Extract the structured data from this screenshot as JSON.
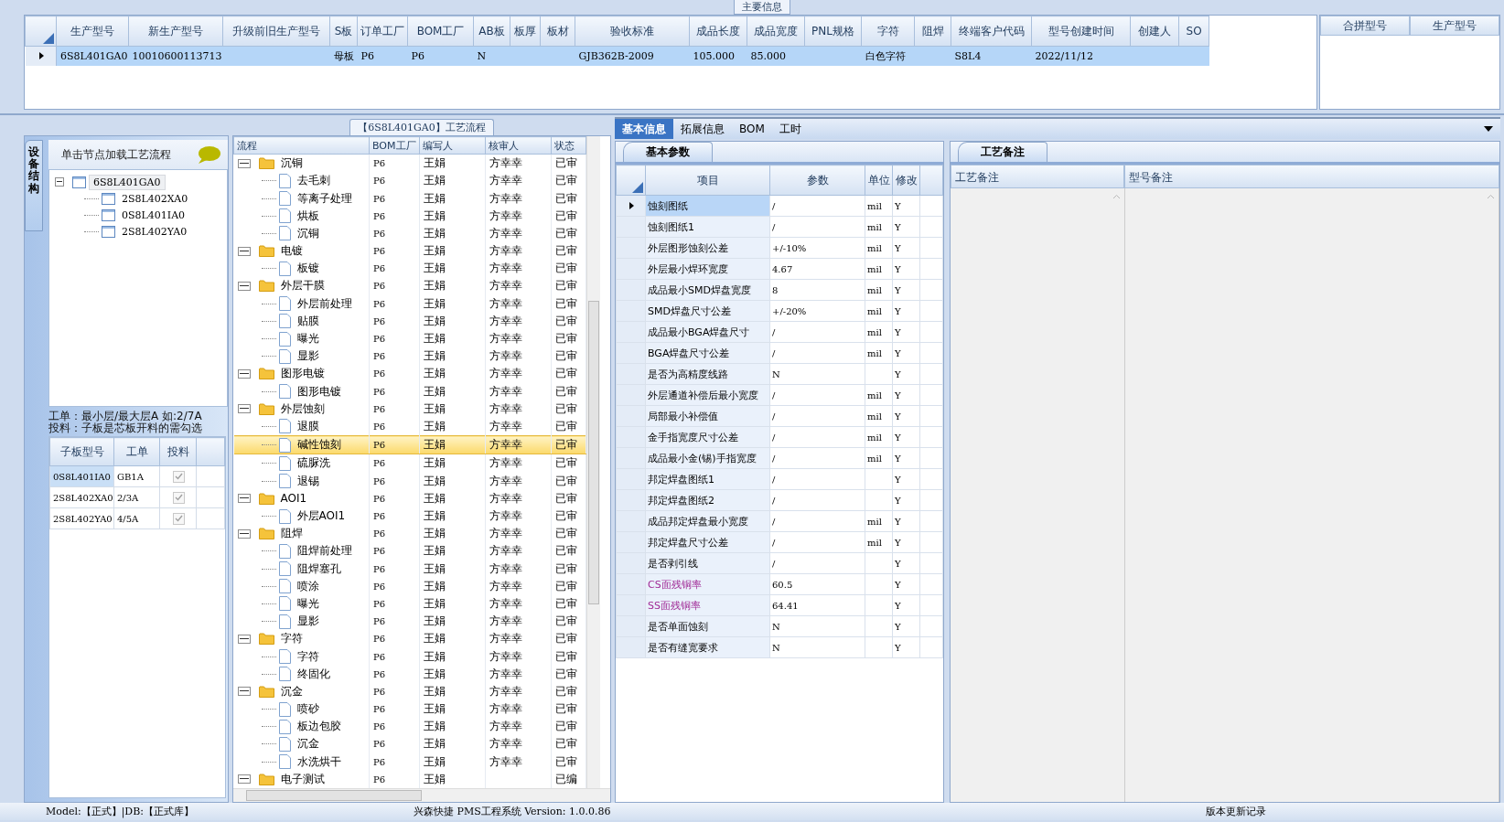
{
  "main_info": {
    "title": "主要信息",
    "columns": [
      "生产型号",
      "新生产型号",
      "升级前旧生产型号",
      "S板",
      "订单工厂",
      "BOM工厂",
      "AB板",
      "板厚",
      "板材",
      "验收标准",
      "成品长度",
      "成品宽度",
      "PNL规格",
      "字符",
      "阻焊",
      "终端客户代码",
      "型号创建时间",
      "创建人",
      "SO"
    ],
    "rows": [
      {
        "selected": true,
        "cells": [
          "6S8L401GA0",
          "10010600113713",
          null,
          "母板",
          "P6",
          "P6",
          "N",
          null,
          null,
          "GJB362B-2009",
          "105.000",
          "85.000",
          null,
          "白色字符",
          null,
          "S8L4",
          "2022/11/12",
          null,
          null
        ]
      }
    ]
  },
  "merge_grid": {
    "columns": [
      "合拼型号",
      "生产型号"
    ]
  },
  "structure_panel": {
    "side_tab": "设备结构",
    "hint": "单击节点加载工艺流程",
    "tree": [
      {
        "label": "6S8L401GA0",
        "expanded": true,
        "selected": true,
        "children": [
          {
            "label": "2S8L402XA0",
            "selected": false
          },
          {
            "label": "0S8L401IA0",
            "selected": false
          },
          {
            "label": "2S8L402YA0",
            "selected": false
          }
        ]
      }
    ],
    "notes": [
      "工单：最小层/最大层A 如:2/7A",
      "投料：子板是芯板开料的需勾选"
    ],
    "sub_boards": {
      "columns": [
        "子板型号",
        "工单",
        "投料"
      ],
      "rows": [
        {
          "cells": [
            "0S8L401IA0",
            "GB1A"
          ],
          "checked": true,
          "selected": true
        },
        {
          "cells": [
            "2S8L402XA0",
            "2/3A"
          ],
          "checked": true,
          "selected": false
        },
        {
          "cells": [
            "2S8L402YA0",
            "4/5A"
          ],
          "checked": true,
          "selected": false
        }
      ]
    }
  },
  "process_panel": {
    "title": "【6S8L401GA0】工艺流程",
    "columns": [
      "流程",
      "BOM工厂",
      "编写人",
      "核审人",
      "状态"
    ],
    "tree": [
      {
        "name": "沉铜",
        "bom": "P6",
        "writer": "王娟",
        "reviewer": "方幸幸",
        "status": "已审",
        "expanded": true,
        "selected": false,
        "children": [
          {
            "name": "去毛刺",
            "bom": "P6",
            "writer": "王娟",
            "reviewer": "方幸幸",
            "status": "已审",
            "selected": false
          },
          {
            "name": "等离子处理",
            "bom": "P6",
            "writer": "王娟",
            "reviewer": "方幸幸",
            "status": "已审",
            "selected": false
          },
          {
            "name": "烘板",
            "bom": "P6",
            "writer": "王娟",
            "reviewer": "方幸幸",
            "status": "已审",
            "selected": false
          },
          {
            "name": "沉铜",
            "bom": "P6",
            "writer": "王娟",
            "reviewer": "方幸幸",
            "status": "已审",
            "selected": false
          }
        ]
      },
      {
        "name": "电镀",
        "bom": "P6",
        "writer": "王娟",
        "reviewer": "方幸幸",
        "status": "已审",
        "expanded": true,
        "selected": false,
        "children": [
          {
            "name": "板镀",
            "bom": "P6",
            "writer": "王娟",
            "reviewer": "方幸幸",
            "status": "已审",
            "selected": false
          }
        ]
      },
      {
        "name": "外层干膜",
        "bom": "P6",
        "writer": "王娟",
        "reviewer": "方幸幸",
        "status": "已审",
        "expanded": true,
        "selected": false,
        "children": [
          {
            "name": "外层前处理",
            "bom": "P6",
            "writer": "王娟",
            "reviewer": "方幸幸",
            "status": "已审",
            "selected": false
          },
          {
            "name": "贴膜",
            "bom": "P6",
            "writer": "王娟",
            "reviewer": "方幸幸",
            "status": "已审",
            "selected": false
          },
          {
            "name": "曝光",
            "bom": "P6",
            "writer": "王娟",
            "reviewer": "方幸幸",
            "status": "已审",
            "selected": false
          },
          {
            "name": "显影",
            "bom": "P6",
            "writer": "王娟",
            "reviewer": "方幸幸",
            "status": "已审",
            "selected": false
          }
        ]
      },
      {
        "name": "图形电镀",
        "bom": "P6",
        "writer": "王娟",
        "reviewer": "方幸幸",
        "status": "已审",
        "expanded": true,
        "selected": false,
        "children": [
          {
            "name": "图形电镀",
            "bom": "P6",
            "writer": "王娟",
            "reviewer": "方幸幸",
            "status": "已审",
            "selected": false
          }
        ]
      },
      {
        "name": "外层蚀刻",
        "bom": "P6",
        "writer": "王娟",
        "reviewer": "方幸幸",
        "status": "已审",
        "expanded": true,
        "selected": false,
        "children": [
          {
            "name": "退膜",
            "bom": "P6",
            "writer": "王娟",
            "reviewer": "方幸幸",
            "status": "已审",
            "selected": false
          },
          {
            "name": "碱性蚀刻",
            "bom": "P6",
            "writer": "王娟",
            "reviewer": "方幸幸",
            "status": "已审",
            "selected": true
          },
          {
            "name": "硫脲洗",
            "bom": "P6",
            "writer": "王娟",
            "reviewer": "方幸幸",
            "status": "已审",
            "selected": false
          },
          {
            "name": "退锡",
            "bom": "P6",
            "writer": "王娟",
            "reviewer": "方幸幸",
            "status": "已审",
            "selected": false
          }
        ]
      },
      {
        "name": "AOI1",
        "bom": "P6",
        "writer": "王娟",
        "reviewer": "方幸幸",
        "status": "已审",
        "expanded": true,
        "selected": false,
        "children": [
          {
            "name": "外层AOI1",
            "bom": "P6",
            "writer": "王娟",
            "reviewer": "方幸幸",
            "status": "已审",
            "selected": false
          }
        ]
      },
      {
        "name": "阻焊",
        "bom": "P6",
        "writer": "王娟",
        "reviewer": "方幸幸",
        "status": "已审",
        "expanded": true,
        "selected": false,
        "children": [
          {
            "name": "阻焊前处理",
            "bom": "P6",
            "writer": "王娟",
            "reviewer": "方幸幸",
            "status": "已审",
            "selected": false
          },
          {
            "name": "阻焊塞孔",
            "bom": "P6",
            "writer": "王娟",
            "reviewer": "方幸幸",
            "status": "已审",
            "selected": false
          },
          {
            "name": "喷涂",
            "bom": "P6",
            "writer": "王娟",
            "reviewer": "方幸幸",
            "status": "已审",
            "selected": false
          },
          {
            "name": "曝光",
            "bom": "P6",
            "writer": "王娟",
            "reviewer": "方幸幸",
            "status": "已审",
            "selected": false
          },
          {
            "name": "显影",
            "bom": "P6",
            "writer": "王娟",
            "reviewer": "方幸幸",
            "status": "已审",
            "selected": false
          }
        ]
      },
      {
        "name": "字符",
        "bom": "P6",
        "writer": "王娟",
        "reviewer": "方幸幸",
        "status": "已审",
        "expanded": true,
        "selected": false,
        "children": [
          {
            "name": "字符",
            "bom": "P6",
            "writer": "王娟",
            "reviewer": "方幸幸",
            "status": "已审",
            "selected": false
          },
          {
            "name": "终固化",
            "bom": "P6",
            "writer": "王娟",
            "reviewer": "方幸幸",
            "status": "已审",
            "selected": false
          }
        ]
      },
      {
        "name": "沉金",
        "bom": "P6",
        "writer": "王娟",
        "reviewer": "方幸幸",
        "status": "已审",
        "expanded": true,
        "selected": false,
        "children": [
          {
            "name": "喷砂",
            "bom": "P6",
            "writer": "王娟",
            "reviewer": "方幸幸",
            "status": "已审",
            "selected": false
          },
          {
            "name": "板边包胶",
            "bom": "P6",
            "writer": "王娟",
            "reviewer": "方幸幸",
            "status": "已审",
            "selected": false
          },
          {
            "name": "沉金",
            "bom": "P6",
            "writer": "王娟",
            "reviewer": "方幸幸",
            "status": "已审",
            "selected": false
          },
          {
            "name": "水洗烘干",
            "bom": "P6",
            "writer": "王娟",
            "reviewer": "方幸幸",
            "status": "已审",
            "selected": false
          }
        ]
      },
      {
        "name": "电子测试",
        "bom": "P6",
        "writer": "王娟",
        "status": "已编",
        "expanded": true,
        "selected": false
      }
    ]
  },
  "detail_tabs": [
    {
      "label": "基本信息",
      "selected": true
    },
    {
      "label": "拓展信息",
      "selected": false
    },
    {
      "label": "BOM",
      "selected": false
    },
    {
      "label": "工时",
      "selected": false
    }
  ],
  "basic_params": {
    "tab": "基本参数",
    "columns": [
      "项目",
      "参数",
      "单位",
      "修改"
    ],
    "rows": [
      {
        "item": "蚀刻图纸",
        "value": "/",
        "unit": "mil",
        "edit": "Y",
        "selected": true,
        "highlighted": false
      },
      {
        "item": "蚀刻图纸1",
        "value": "/",
        "unit": "mil",
        "edit": "Y",
        "selected": false,
        "highlighted": false
      },
      {
        "item": "外层图形蚀刻公差",
        "value": "+/-10%",
        "unit": "mil",
        "edit": "Y",
        "selected": false,
        "highlighted": false
      },
      {
        "item": "外层最小焊环宽度",
        "value": "4.67",
        "unit": "mil",
        "edit": "Y",
        "selected": false,
        "highlighted": false
      },
      {
        "item": "成品最小SMD焊盘宽度",
        "value": "8",
        "unit": "mil",
        "edit": "Y",
        "selected": false,
        "highlighted": false
      },
      {
        "item": "SMD焊盘尺寸公差",
        "value": "+/-20%",
        "unit": "mil",
        "edit": "Y",
        "selected": false,
        "highlighted": false
      },
      {
        "item": "成品最小BGA焊盘尺寸",
        "value": "/",
        "unit": "mil",
        "edit": "Y",
        "selected": false,
        "highlighted": false
      },
      {
        "item": "BGA焊盘尺寸公差",
        "value": "/",
        "unit": "mil",
        "edit": "Y",
        "selected": false,
        "highlighted": false
      },
      {
        "item": "是否为高精度线路",
        "value": "N",
        "edit": "Y",
        "selected": false,
        "highlighted": false
      },
      {
        "item": "外层通道补偿后最小宽度",
        "value": "/",
        "unit": "mil",
        "edit": "Y",
        "selected": false,
        "highlighted": false
      },
      {
        "item": "局部最小补偿值",
        "value": "/",
        "unit": "mil",
        "edit": "Y",
        "selected": false,
        "highlighted": false
      },
      {
        "item": "金手指宽度尺寸公差",
        "value": "/",
        "unit": "mil",
        "edit": "Y",
        "selected": false,
        "highlighted": false
      },
      {
        "item": "成品最小金(锡)手指宽度",
        "value": "/",
        "unit": "mil",
        "edit": "Y",
        "selected": false,
        "highlighted": false
      },
      {
        "item": "邦定焊盘图纸1",
        "value": "/",
        "edit": "Y",
        "selected": false,
        "highlighted": false
      },
      {
        "item": "邦定焊盘图纸2",
        "value": "/",
        "edit": "Y",
        "selected": false,
        "highlighted": false
      },
      {
        "item": "成品邦定焊盘最小宽度",
        "value": "/",
        "unit": "mil",
        "edit": "Y",
        "selected": false,
        "highlighted": false
      },
      {
        "item": "邦定焊盘尺寸公差",
        "value": "/",
        "unit": "mil",
        "edit": "Y",
        "selected": false,
        "highlighted": false
      },
      {
        "item": "是否剥引线",
        "value": "/",
        "edit": "Y",
        "selected": false,
        "highlighted": false
      },
      {
        "item": "CS面残铜率",
        "value": "60.5",
        "edit": "Y",
        "selected": false,
        "highlighted": true
      },
      {
        "item": "SS面残铜率",
        "value": "64.41",
        "edit": "Y",
        "selected": false,
        "highlighted": true
      },
      {
        "item": "是否单面蚀刻",
        "value": "N",
        "edit": "Y",
        "selected": false,
        "highlighted": false
      },
      {
        "item": "是否有缝宽要求",
        "value": "N",
        "edit": "Y",
        "selected": false,
        "highlighted": false
      }
    ]
  },
  "remarks": {
    "tab": "工艺备注",
    "columns": [
      "工艺备注",
      "型号备注"
    ]
  },
  "status_bar": {
    "left": "Model:【正式】|DB:【正式库】",
    "center": "兴森快捷 PMS工程系统 Version: 1.0.0.86",
    "right": "版本更新记录"
  }
}
